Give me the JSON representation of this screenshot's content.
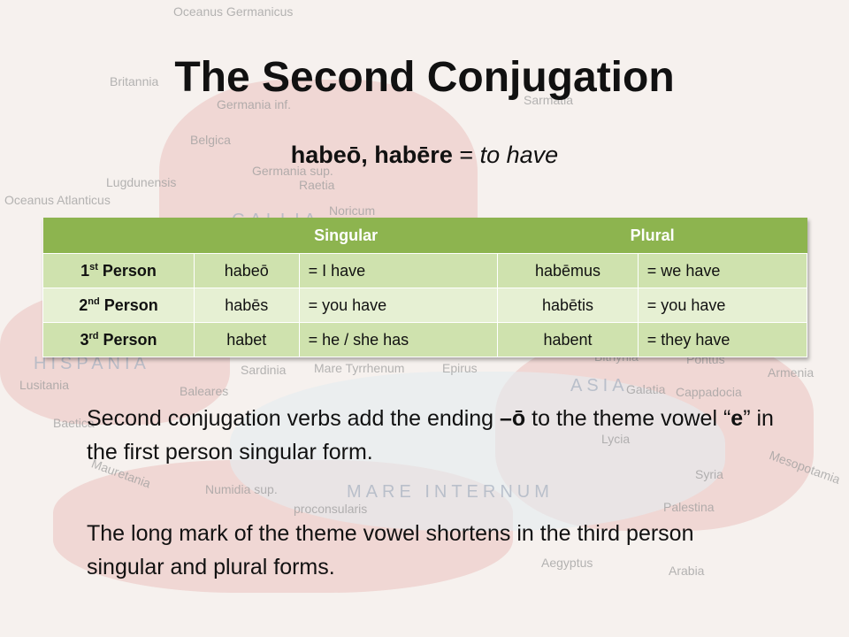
{
  "background_map": {
    "labels": [
      "Oceanus Germanicus",
      "Britannia",
      "Germania inf.",
      "Sarmatia",
      "Belgica",
      "Germania sup.",
      "Lugdunensis",
      "Raetia",
      "Oceanus Atlanticus",
      "GALLIA",
      "Noricum",
      "HISPANIA",
      "Lusitania",
      "Sardinia",
      "Mare Tyrrhenum",
      "Epirus",
      "Bithynia",
      "Pontus",
      "Armenia",
      "ASIA",
      "Galatia",
      "Cappadocia",
      "Baleares",
      "Baetica",
      "Lycia",
      "Mauretania",
      "Numidia sup.",
      "proconsularis",
      "Syria",
      "Mesopotamia",
      "MARE INTERNUM",
      "Palestina",
      "Aegyptus",
      "Arabia"
    ]
  },
  "slide": {
    "title": "The Second Conjugation",
    "subtitle": {
      "verb": "habeō, habēre",
      "equals": " = ",
      "meaning": "to have"
    },
    "table": {
      "headers": [
        "",
        "Singular",
        "Plural"
      ],
      "rows": [
        {
          "num": "1",
          "suffix": "st",
          "person": " Person",
          "sg": "habeō",
          "sg_en": "= I have",
          "pl": "habēmus",
          "pl_en": "= we have"
        },
        {
          "num": "2",
          "suffix": "nd",
          "person": " Person",
          "sg": "habēs",
          "sg_en": "= you have",
          "pl": "habētis",
          "pl_en": "= you have"
        },
        {
          "num": "3",
          "suffix": "rd",
          "person": " Person",
          "sg": "habet",
          "sg_en": "= he / she has",
          "pl": "habent",
          "pl_en": "= they have"
        }
      ]
    },
    "para1": {
      "a": "Second conjugation verbs add the ending ",
      "b": "–ō",
      "c": " to the theme vowel “",
      "d": "e",
      "e": "” in the first person singular form."
    },
    "para2": "The long mark of the theme vowel shortens in the third person singular and plural forms."
  },
  "colors": {
    "header": "#8db44f",
    "row_dark": "#cfe2ae",
    "row_light": "#e6f0d3"
  }
}
